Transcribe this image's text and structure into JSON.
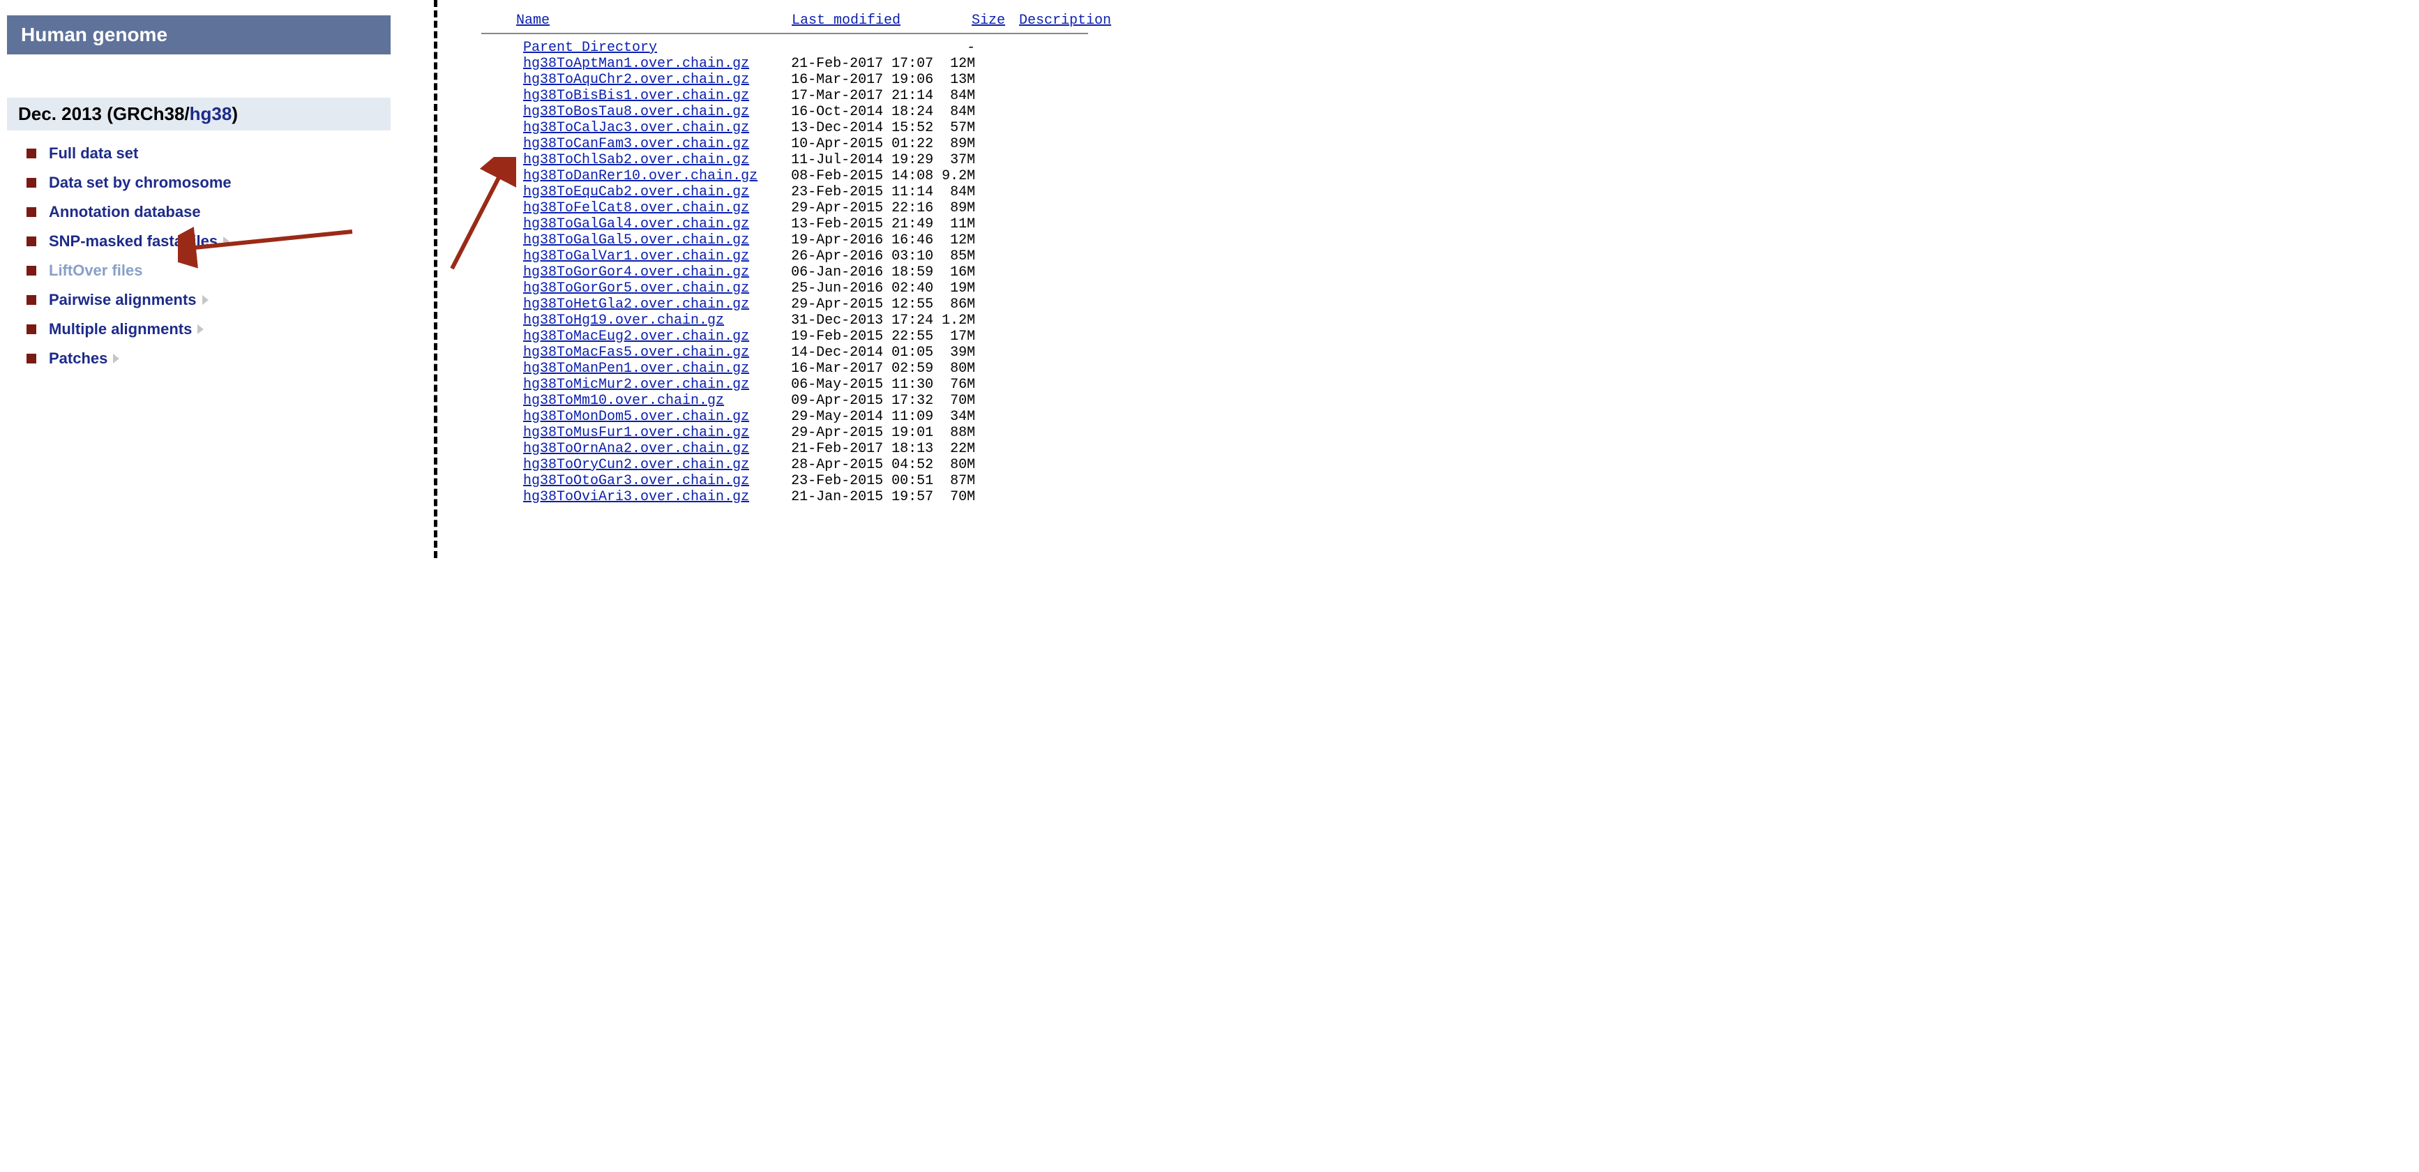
{
  "left": {
    "header": "Human genome",
    "subheader_prefix": "Dec. 2013 (GRCh38/",
    "subheader_asm": "hg38",
    "subheader_suffix": ")",
    "items": [
      {
        "label": "Full data set",
        "caret": false,
        "dim": false
      },
      {
        "label": "Data set by chromosome",
        "caret": false,
        "dim": false
      },
      {
        "label": "Annotation database",
        "caret": false,
        "dim": false
      },
      {
        "label": "SNP-masked fasta files",
        "caret": true,
        "dim": false
      },
      {
        "label": "LiftOver files",
        "caret": false,
        "dim": true
      },
      {
        "label": "Pairwise alignments",
        "caret": true,
        "dim": false
      },
      {
        "label": "Multiple alignments",
        "caret": true,
        "dim": false
      },
      {
        "label": "Patches",
        "caret": true,
        "dim": false
      }
    ]
  },
  "listing": {
    "cols": {
      "name": "Name",
      "modified": "Last modified",
      "size": "Size",
      "desc": "Description"
    },
    "parent": "Parent Directory",
    "name_pad": 32,
    "rows": [
      {
        "name": "hg38ToAptMan1.over.chain.gz",
        "mod": "21-Feb-2017 17:07",
        "size": "12M"
      },
      {
        "name": "hg38ToAquChr2.over.chain.gz",
        "mod": "16-Mar-2017 19:06",
        "size": "13M"
      },
      {
        "name": "hg38ToBisBis1.over.chain.gz",
        "mod": "17-Mar-2017 21:14",
        "size": "84M"
      },
      {
        "name": "hg38ToBosTau8.over.chain.gz",
        "mod": "16-Oct-2014 18:24",
        "size": "84M"
      },
      {
        "name": "hg38ToCalJac3.over.chain.gz",
        "mod": "13-Dec-2014 15:52",
        "size": "57M"
      },
      {
        "name": "hg38ToCanFam3.over.chain.gz",
        "mod": "10-Apr-2015 01:22",
        "size": "89M"
      },
      {
        "name": "hg38ToChlSab2.over.chain.gz",
        "mod": "11-Jul-2014 19:29",
        "size": "37M"
      },
      {
        "name": "hg38ToDanRer10.over.chain.gz",
        "mod": "08-Feb-2015 14:08",
        "size": "9.2M"
      },
      {
        "name": "hg38ToEquCab2.over.chain.gz",
        "mod": "23-Feb-2015 11:14",
        "size": "84M"
      },
      {
        "name": "hg38ToFelCat8.over.chain.gz",
        "mod": "29-Apr-2015 22:16",
        "size": "89M"
      },
      {
        "name": "hg38ToGalGal4.over.chain.gz",
        "mod": "13-Feb-2015 21:49",
        "size": "11M"
      },
      {
        "name": "hg38ToGalGal5.over.chain.gz",
        "mod": "19-Apr-2016 16:46",
        "size": "12M"
      },
      {
        "name": "hg38ToGalVar1.over.chain.gz",
        "mod": "26-Apr-2016 03:10",
        "size": "85M"
      },
      {
        "name": "hg38ToGorGor4.over.chain.gz",
        "mod": "06-Jan-2016 18:59",
        "size": "16M"
      },
      {
        "name": "hg38ToGorGor5.over.chain.gz",
        "mod": "25-Jun-2016 02:40",
        "size": "19M"
      },
      {
        "name": "hg38ToHetGla2.over.chain.gz",
        "mod": "29-Apr-2015 12:55",
        "size": "86M"
      },
      {
        "name": "hg38ToHg19.over.chain.gz",
        "mod": "31-Dec-2013 17:24",
        "size": "1.2M"
      },
      {
        "name": "hg38ToMacEug2.over.chain.gz",
        "mod": "19-Feb-2015 22:55",
        "size": "17M"
      },
      {
        "name": "hg38ToMacFas5.over.chain.gz",
        "mod": "14-Dec-2014 01:05",
        "size": "39M"
      },
      {
        "name": "hg38ToManPen1.over.chain.gz",
        "mod": "16-Mar-2017 02:59",
        "size": "80M"
      },
      {
        "name": "hg38ToMicMur2.over.chain.gz",
        "mod": "06-May-2015 11:30",
        "size": "76M"
      },
      {
        "name": "hg38ToMm10.over.chain.gz",
        "mod": "09-Apr-2015 17:32",
        "size": "70M"
      },
      {
        "name": "hg38ToMonDom5.over.chain.gz",
        "mod": "29-May-2014 11:09",
        "size": "34M"
      },
      {
        "name": "hg38ToMusFur1.over.chain.gz",
        "mod": "29-Apr-2015 19:01",
        "size": "88M"
      },
      {
        "name": "hg38ToOrnAna2.over.chain.gz",
        "mod": "21-Feb-2017 18:13",
        "size": "22M"
      },
      {
        "name": "hg38ToOryCun2.over.chain.gz",
        "mod": "28-Apr-2015 04:52",
        "size": "80M"
      },
      {
        "name": "hg38ToOtoGar3.over.chain.gz",
        "mod": "23-Feb-2015 00:51",
        "size": "87M"
      },
      {
        "name": "hg38ToOviAri3.over.chain.gz",
        "mod": "21-Jan-2015 19:57",
        "size": "70M"
      }
    ]
  }
}
